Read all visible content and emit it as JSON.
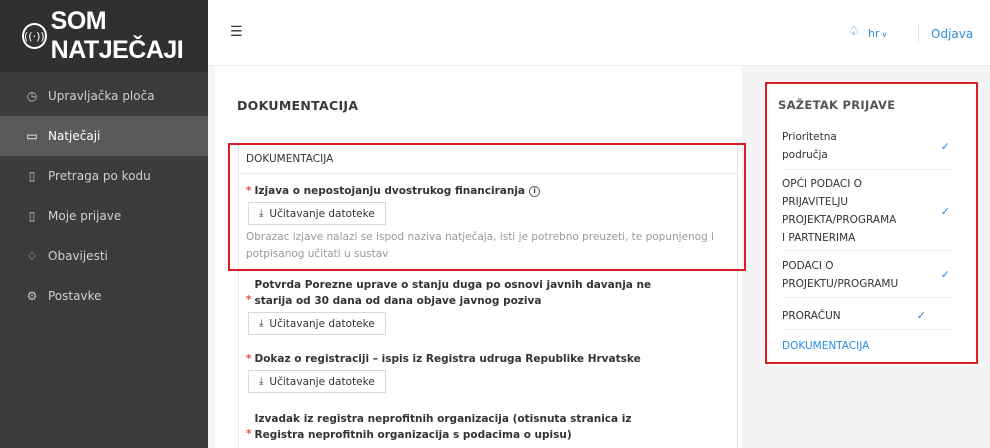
{
  "brand": {
    "logo_mark": "((·))",
    "name": "SOM NATJEČAJI"
  },
  "sidebar": {
    "items": [
      {
        "label": "Upravljačka ploča",
        "icon": "◷"
      },
      {
        "label": "Natječaji",
        "icon": "▭"
      },
      {
        "label": "Pretraga po kodu",
        "icon": "▯"
      },
      {
        "label": "Moje prijave",
        "icon": "▯"
      },
      {
        "label": "Obavijesti",
        "icon": "♢"
      },
      {
        "label": "Postavke",
        "icon": "⚙"
      }
    ]
  },
  "header": {
    "menu_icon": "☰",
    "bell_icon": "♤",
    "language": "hr",
    "language_arrow": "∨",
    "logout": "Odjava"
  },
  "main": {
    "section_title": "DOKUMENTACIJA",
    "inner_title": "DOKUMENTACIJA",
    "fields": [
      {
        "required_mark": "*",
        "label_lines": [
          "Izjava o nepostojanju dvostrukog financiranja"
        ],
        "info_icon": "i",
        "upload_label": "Učitavanje datoteke",
        "hint": "Obrazac izjave nalazi se ispod naziva natječaja, isti je potrebno preuzeti, te popunjenog i potpisanog učitati u sustav"
      },
      {
        "required_mark": "*",
        "label_lines": [
          "Potvrda Porezne uprave o stanju duga po osnovi javnih davanja ne",
          "starija od 30 dana od dana objave javnog poziva"
        ],
        "upload_label": "Učitavanje datoteke"
      },
      {
        "required_mark": "*",
        "label_lines": [
          "Dokaz o registraciji – ispis iz Registra udruga Republike Hrvatske"
        ],
        "upload_label": "Učitavanje datoteke"
      },
      {
        "required_mark": "*",
        "label_lines": [
          "Izvadak iz registra neprofitnih organizacija (otisnuta stranica iz",
          "Registra neprofitnih organizacija s podacima o upisu)"
        ]
      }
    ],
    "upload_icon": "⤓"
  },
  "summary": {
    "title": "SAŽETAK PRIJAVE",
    "check_icon": "✓",
    "items": [
      {
        "lines": [
          "Prioritetna",
          "područja"
        ],
        "checked": true
      },
      {
        "lines": [
          "OPĆI PODACI O",
          "PRIJAVITELJU",
          "PROJEKTA/PROGRAMA",
          "I PARTNERIMA"
        ],
        "checked": true
      },
      {
        "lines": [
          "PODACI O",
          "PROJEKTU/PROGRAMU"
        ],
        "checked": true
      },
      {
        "lines": [
          "PRORAČUN"
        ],
        "checked": true
      },
      {
        "lines": [
          "DOKUMENTACIJA"
        ],
        "checked": false,
        "active": true
      }
    ]
  },
  "colors": {
    "accent": "#2c8be0",
    "highlight": "#dd1d25",
    "sidebar": "#3b3b3b",
    "sidebar_active": "#5a5a5a"
  }
}
